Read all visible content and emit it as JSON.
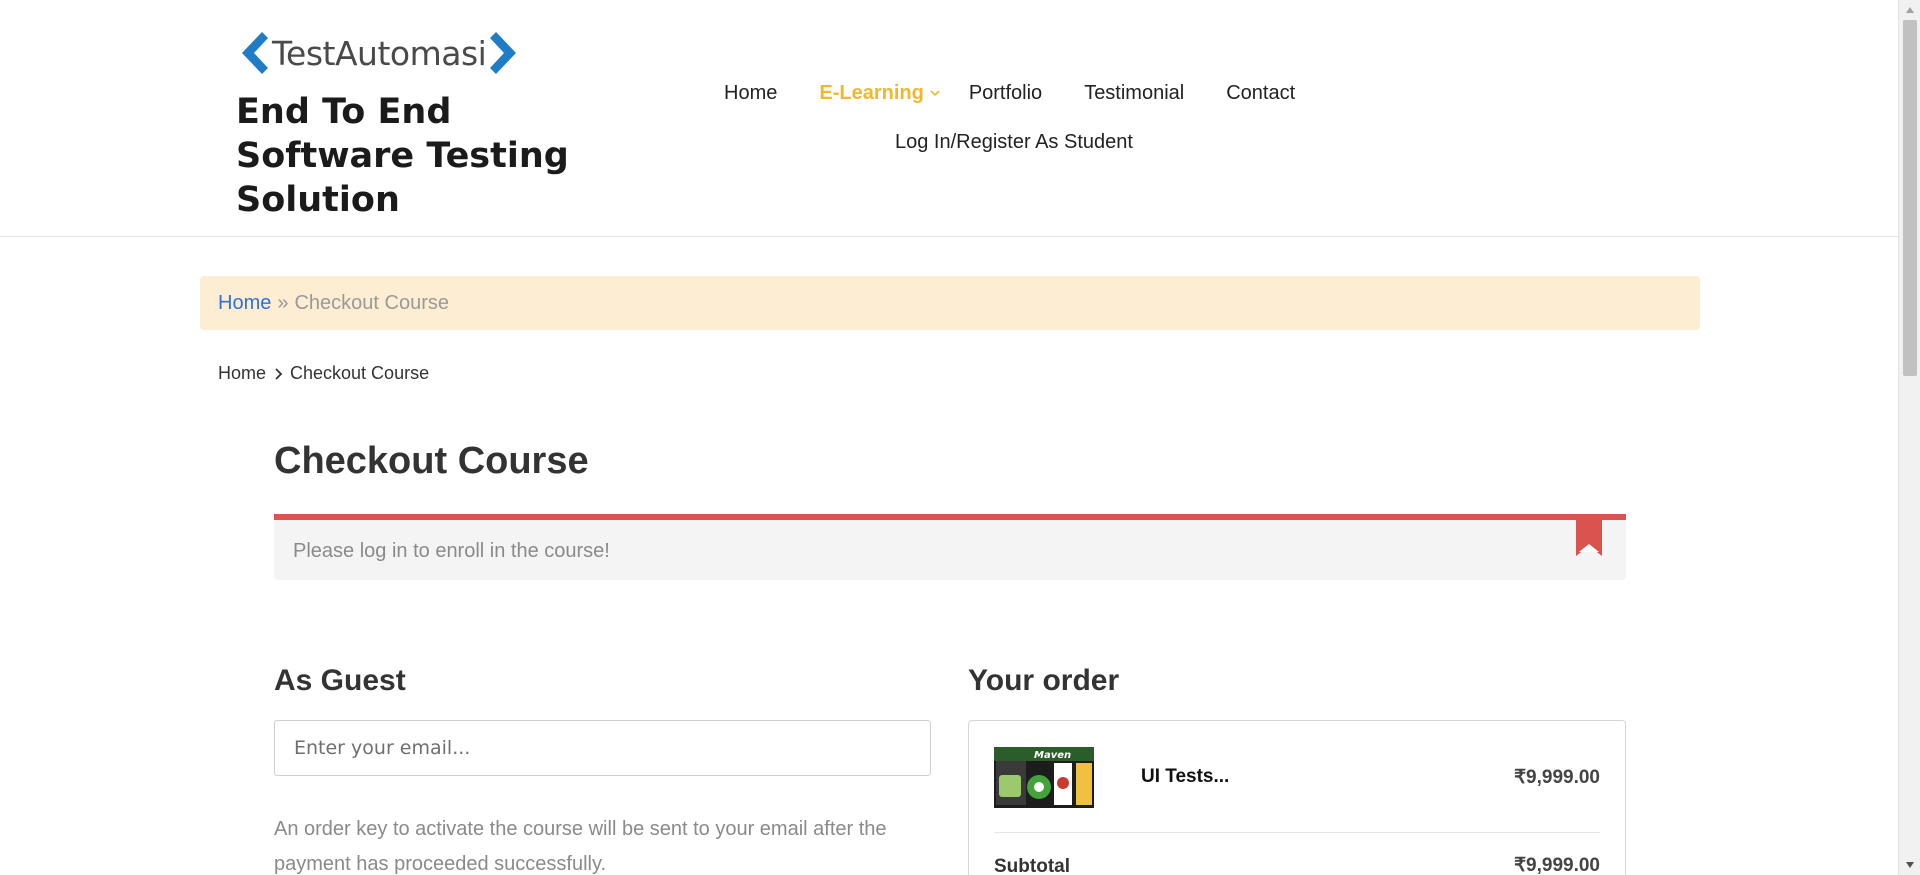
{
  "header": {
    "logo_text": "TestAutomasi",
    "tagline": "End To End Software Testing Solution",
    "nav": [
      {
        "label": "Home"
      },
      {
        "label": "E-Learning"
      },
      {
        "label": "Portfolio"
      },
      {
        "label": "Testimonial"
      },
      {
        "label": "Contact"
      }
    ],
    "nav_second_row": "Log In/Register As Student",
    "accent_color": "#f0b92b"
  },
  "breadcrumb_banner": {
    "home": "Home",
    "separator": "»",
    "current": "Checkout Course"
  },
  "breadcrumb": {
    "home": "Home",
    "current": "Checkout Course"
  },
  "page_title": "Checkout Course",
  "notice": {
    "message": "Please log in to enroll in the course!",
    "color": "#d9534f"
  },
  "guest": {
    "title": "As Guest",
    "email_placeholder": "Enter your email...",
    "note": "An order key to activate the course will be sent to your email after the payment has proceeded successfully."
  },
  "order": {
    "title": "Your order",
    "item_name": "UI Tests...",
    "item_price": "₹9,999.00",
    "subtotal_label": "Subtotal",
    "subtotal_value": "₹9,999.00",
    "thumbnail_caption": "Maven"
  }
}
